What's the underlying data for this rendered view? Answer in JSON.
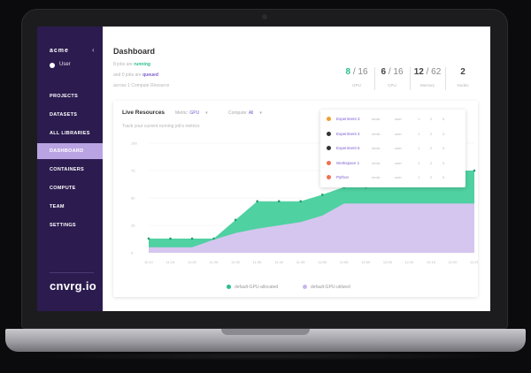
{
  "sidebar": {
    "brand": "acme",
    "collapse_icon": "chevron-left-icon",
    "user": "User",
    "items": [
      {
        "label": "PROJECTS",
        "active": false
      },
      {
        "label": "DATASETS",
        "active": false
      },
      {
        "label": "ALL LIBRARIES",
        "active": false
      },
      {
        "label": "DASHBOARD",
        "active": true
      },
      {
        "label": "CONTAINERS",
        "active": false
      },
      {
        "label": "COMPUTE",
        "active": false
      },
      {
        "label": "TEAM",
        "active": false
      },
      {
        "label": "SETTINGS",
        "active": false
      }
    ],
    "logo": "cnvrg.io"
  },
  "header": {
    "title": "Dashboard",
    "info": [
      {
        "prefix": "8 jobs are ",
        "highlight": "running",
        "color": "#2bbf87"
      },
      {
        "prefix": "and 0 jobs are ",
        "highlight": "queued",
        "color": "#7b5bd0"
      },
      {
        "prefix": "across 1 Compute Resource",
        "highlight": "",
        "color": "#b5b5b5"
      }
    ]
  },
  "stats": [
    {
      "value": "8",
      "total": "16",
      "label": "GPU",
      "color": "#2bbf87"
    },
    {
      "value": "6",
      "total": "16",
      "label": "CPU",
      "color": "#444444"
    },
    {
      "value": "12",
      "total": "62",
      "label": "Memory",
      "color": "#444444"
    },
    {
      "value": "2",
      "total": "",
      "label": "Nodes",
      "color": "#444444"
    }
  ],
  "live": {
    "title": "Live Resources",
    "metric_label": "Metric:",
    "metric_value": "GPU",
    "compute_label": "Compute:",
    "compute_value": "All",
    "subtitle": "Track your current running job's metrics"
  },
  "popup": {
    "rows": [
      {
        "name": "Experiment 3",
        "icon_color": "#f0a030",
        "cells": [
          "mmlc",
          "user",
          "1",
          "2",
          "3"
        ]
      },
      {
        "name": "Experiment 4",
        "icon_color": "#333333",
        "cells": [
          "mmlc",
          "user",
          "1",
          "2",
          "3"
        ]
      },
      {
        "name": "Experiment 5",
        "icon_color": "#333333",
        "cells": [
          "mmlc",
          "user",
          "1",
          "2",
          "3"
        ]
      },
      {
        "name": "Workspace 1",
        "icon_color": "#f07050",
        "cells": [
          "mmlc",
          "user",
          "1",
          "2",
          "3"
        ]
      },
      {
        "name": "Python",
        "icon_color": "#f07050",
        "cells": [
          "mmlc",
          "user",
          "1",
          "2",
          "3"
        ]
      }
    ]
  },
  "chart_data": {
    "type": "area",
    "x": [
      "11:10",
      "11:15",
      "11:20",
      "11:25",
      "11:30",
      "11:35",
      "11:40",
      "11:45",
      "11:50",
      "11:55",
      "12:00",
      "12:05",
      "12:10",
      "12:15",
      "12:20",
      "12:25"
    ],
    "ylim": [
      0,
      100
    ],
    "yticks": [
      "0",
      "25",
      "50",
      "75",
      "100"
    ],
    "series": [
      {
        "name": "default-GPU-allocated",
        "color": "#4fd1a1",
        "values": [
          13,
          13,
          13,
          13,
          30,
          47,
          47,
          47,
          53,
          60,
          60,
          75,
          75,
          75,
          75,
          75
        ]
      },
      {
        "name": "default-GPU-utilized",
        "color": "#d5c6ef",
        "values": [
          5,
          5,
          5,
          12,
          18,
          22,
          25,
          28,
          34,
          45,
          45,
          45,
          45,
          45,
          45,
          45
        ]
      }
    ],
    "legend": "bottom"
  }
}
